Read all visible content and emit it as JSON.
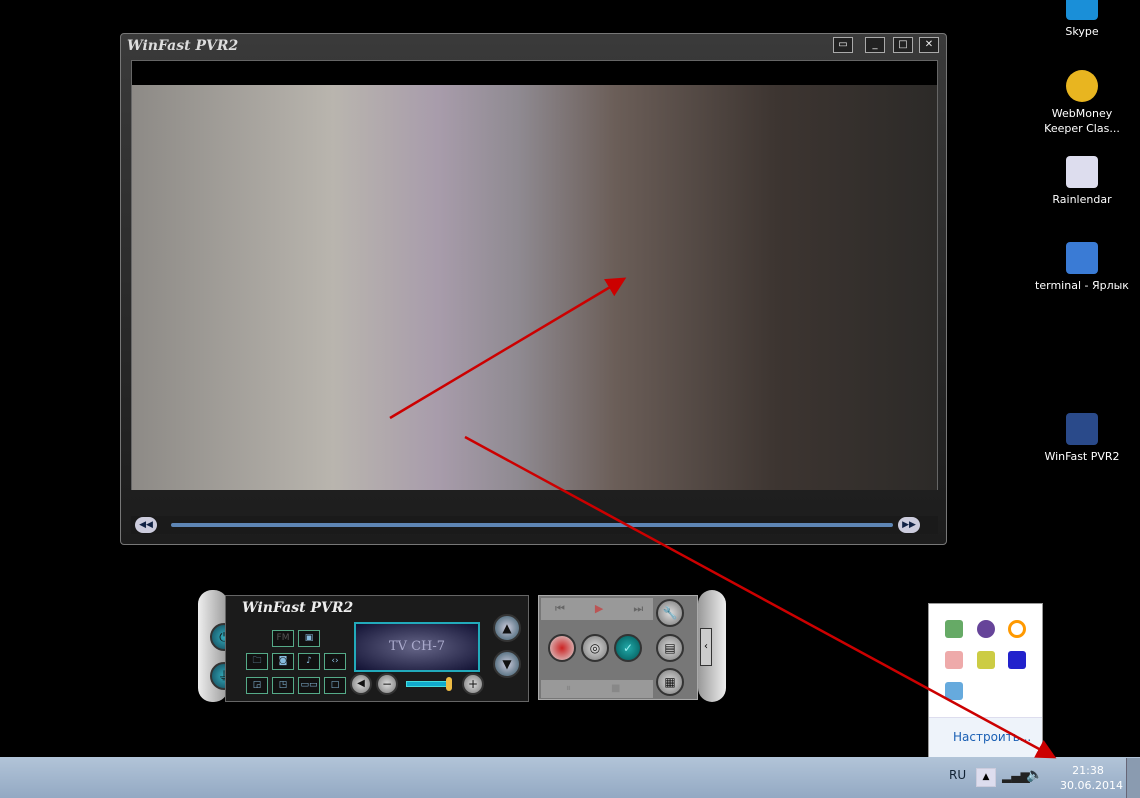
{
  "window": {
    "title": "WinFast PVR2",
    "buttons": [
      "▭",
      "_",
      "□",
      "✕"
    ],
    "seek_back": "◀◀",
    "seek_fwd": "▶▶"
  },
  "desktop_icons": [
    {
      "label": "Skype",
      "color": "#1a8fd8"
    },
    {
      "label": "WebMoney Keeper Clas...",
      "color": "#e8b520"
    },
    {
      "label": "Rainlendar",
      "color": "#dde"
    },
    {
      "label": "terminal - Ярлык",
      "color": "#3a7bd5"
    },
    {
      "label": "WinFast PVR2",
      "color": "#2a4a8a"
    }
  ],
  "panel": {
    "logo": "WinFast PVR2",
    "display": "TV CH-7",
    "fm": "FM",
    "volume_level": 0.85
  },
  "tray_popup": {
    "customize": "Настроить..."
  },
  "taskbar": {
    "language": "RU",
    "time": "21:38",
    "date": "30.06.2014"
  },
  "annotation_color": "#cc0000"
}
